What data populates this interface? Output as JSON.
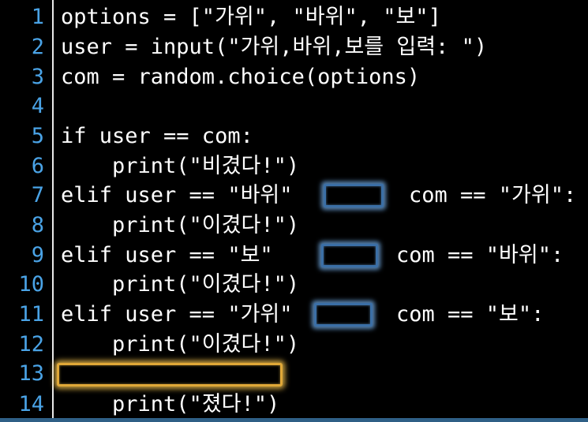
{
  "editor": {
    "lines": [
      {
        "n": "1",
        "code": "options = [\"가위\", \"바위\", \"보\"]"
      },
      {
        "n": "2",
        "code": "user = input(\"가위,바위,보를 입력: \")"
      },
      {
        "n": "3",
        "code": "com = random.choice(options)"
      },
      {
        "n": "4",
        "code": ""
      },
      {
        "n": "5",
        "code": "if user == com:"
      },
      {
        "n": "6",
        "code": "    print(\"비겼다!\")"
      },
      {
        "n": "7",
        "code": "elif user == \"바위\"",
        "after": "com == \"가위\":"
      },
      {
        "n": "8",
        "code": "    print(\"이겼다!\")"
      },
      {
        "n": "9",
        "code": "elif user == \"보\"",
        "after": "com == \"바위\":"
      },
      {
        "n": "10",
        "code": "    print(\"이겼다!\")"
      },
      {
        "n": "11",
        "code": "elif user == \"가위\"",
        "after": "com == \"보\":"
      },
      {
        "n": "12",
        "code": "    print(\"이겼다!\")"
      },
      {
        "n": "13",
        "code": ""
      },
      {
        "n": "14",
        "code": "    print(\"졌다!\")"
      }
    ]
  },
  "colors": {
    "line_number": "#4aa3e6",
    "code_text": "#ffffff",
    "blank_blue_glow": "#3b6fa6",
    "blank_yellow_glow": "#e0a838",
    "background": "#000000"
  }
}
